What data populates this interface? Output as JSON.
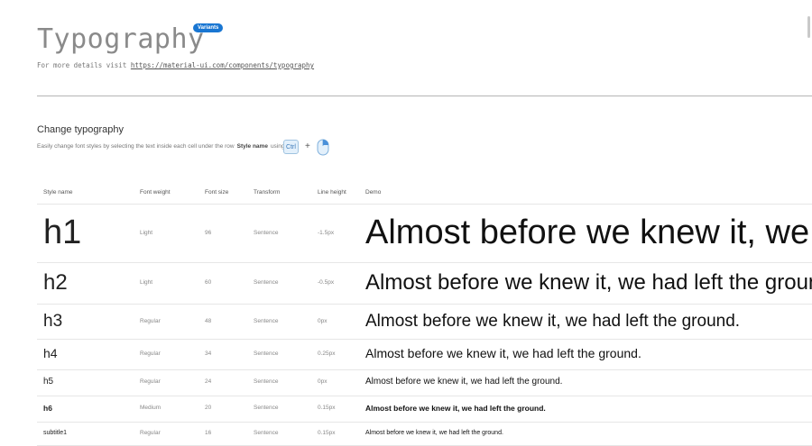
{
  "header": {
    "title": "Typography",
    "badge": "Variants",
    "details_prefix": "For more details visit",
    "details_link": "https://material-ui.com/components/typography"
  },
  "section": {
    "title": "Change typography",
    "desc_prefix": "Easily change font styles by selecting the text inside each cell under the row",
    "desc_bold": "Style name",
    "desc_suffix": "using",
    "ctrl_key": "Ctrl",
    "plus": "+"
  },
  "table": {
    "headers": {
      "style_name": "Style name",
      "font_weight": "Font weight",
      "font_size": "Font size",
      "transform": "Transform",
      "line_height": "Line height",
      "demo": "Demo"
    },
    "rows": [
      {
        "style": "h1",
        "weight": "Light",
        "size": "96",
        "transform": "Sentence",
        "line_height": "-1.5px",
        "demo": "Almost before we knew it, we had left the ground."
      },
      {
        "style": "h2",
        "weight": "Light",
        "size": "60",
        "transform": "Sentence",
        "line_height": "-0.5px",
        "demo": "Almost before we knew it, we had left the ground."
      },
      {
        "style": "h3",
        "weight": "Regular",
        "size": "48",
        "transform": "Sentence",
        "line_height": "0px",
        "demo": "Almost before we knew it, we had left the ground."
      },
      {
        "style": "h4",
        "weight": "Regular",
        "size": "34",
        "transform": "Sentence",
        "line_height": "0.25px",
        "demo": "Almost before we knew it, we had left the ground."
      },
      {
        "style": "h5",
        "weight": "Regular",
        "size": "24",
        "transform": "Sentence",
        "line_height": "0px",
        "demo": "Almost before we knew it, we had left the ground."
      },
      {
        "style": "h6",
        "weight": "Medium",
        "size": "20",
        "transform": "Sentence",
        "line_height": "0.15px",
        "demo": "Almost before we knew it, we had left the ground."
      },
      {
        "style": "subtitle1",
        "weight": "Regular",
        "size": "16",
        "transform": "Sentence",
        "line_height": "0.15px",
        "demo": "Almost before we knew it, we had left the ground."
      }
    ]
  },
  "colors": {
    "badge": "#1976d2",
    "title": "#8a8a8a",
    "ctrl_key_bg": "#e3f0fb"
  },
  "icons": [
    "mouse-click-icon"
  ]
}
